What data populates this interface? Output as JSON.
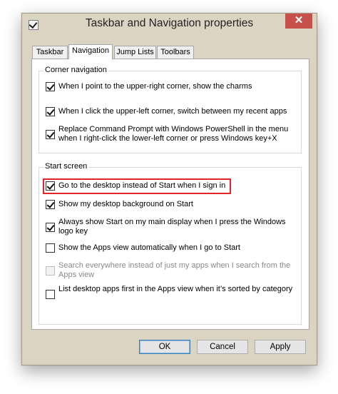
{
  "window": {
    "title": "Taskbar and Navigation properties",
    "close_glyph": "✕",
    "app_icon": "checkmark-app-icon"
  },
  "tabs": [
    {
      "label": "Taskbar",
      "active": false
    },
    {
      "label": "Navigation",
      "active": true
    },
    {
      "label": "Jump Lists",
      "active": false
    },
    {
      "label": "Toolbars",
      "active": false
    }
  ],
  "corner_navigation": {
    "label": "Corner navigation",
    "options": [
      {
        "text": "When I point to the upper-right corner, show the charms",
        "checked": true,
        "enabled": true
      },
      {
        "text": "When I click the upper-left corner, switch between my recent apps",
        "checked": true,
        "enabled": true
      },
      {
        "text": "Replace Command Prompt with Windows PowerShell in the menu when I right-click the lower-left corner or press Windows key+X",
        "checked": true,
        "enabled": true
      }
    ]
  },
  "start_screen": {
    "label": "Start screen",
    "options": [
      {
        "text": "Go to the desktop instead of Start when I sign in",
        "checked": true,
        "enabled": true,
        "highlighted": true
      },
      {
        "text": "Show my desktop background on Start",
        "checked": true,
        "enabled": true
      },
      {
        "text": "Always show Start on my main display when I press the Windows logo key",
        "checked": true,
        "enabled": true
      },
      {
        "text": "Show the Apps view automatically when I go to Start",
        "checked": false,
        "enabled": true
      },
      {
        "text": "Search everywhere instead of just my apps when I search from the Apps view",
        "checked": false,
        "enabled": false
      },
      {
        "text": "List desktop apps first in the Apps view when it’s sorted by category",
        "checked": false,
        "enabled": true
      }
    ]
  },
  "buttons": {
    "ok": "OK",
    "cancel": "Cancel",
    "apply": "Apply"
  },
  "colors": {
    "highlight": "#e0262c",
    "close_button": "#c7504a",
    "frame": "#dcd4c3"
  }
}
